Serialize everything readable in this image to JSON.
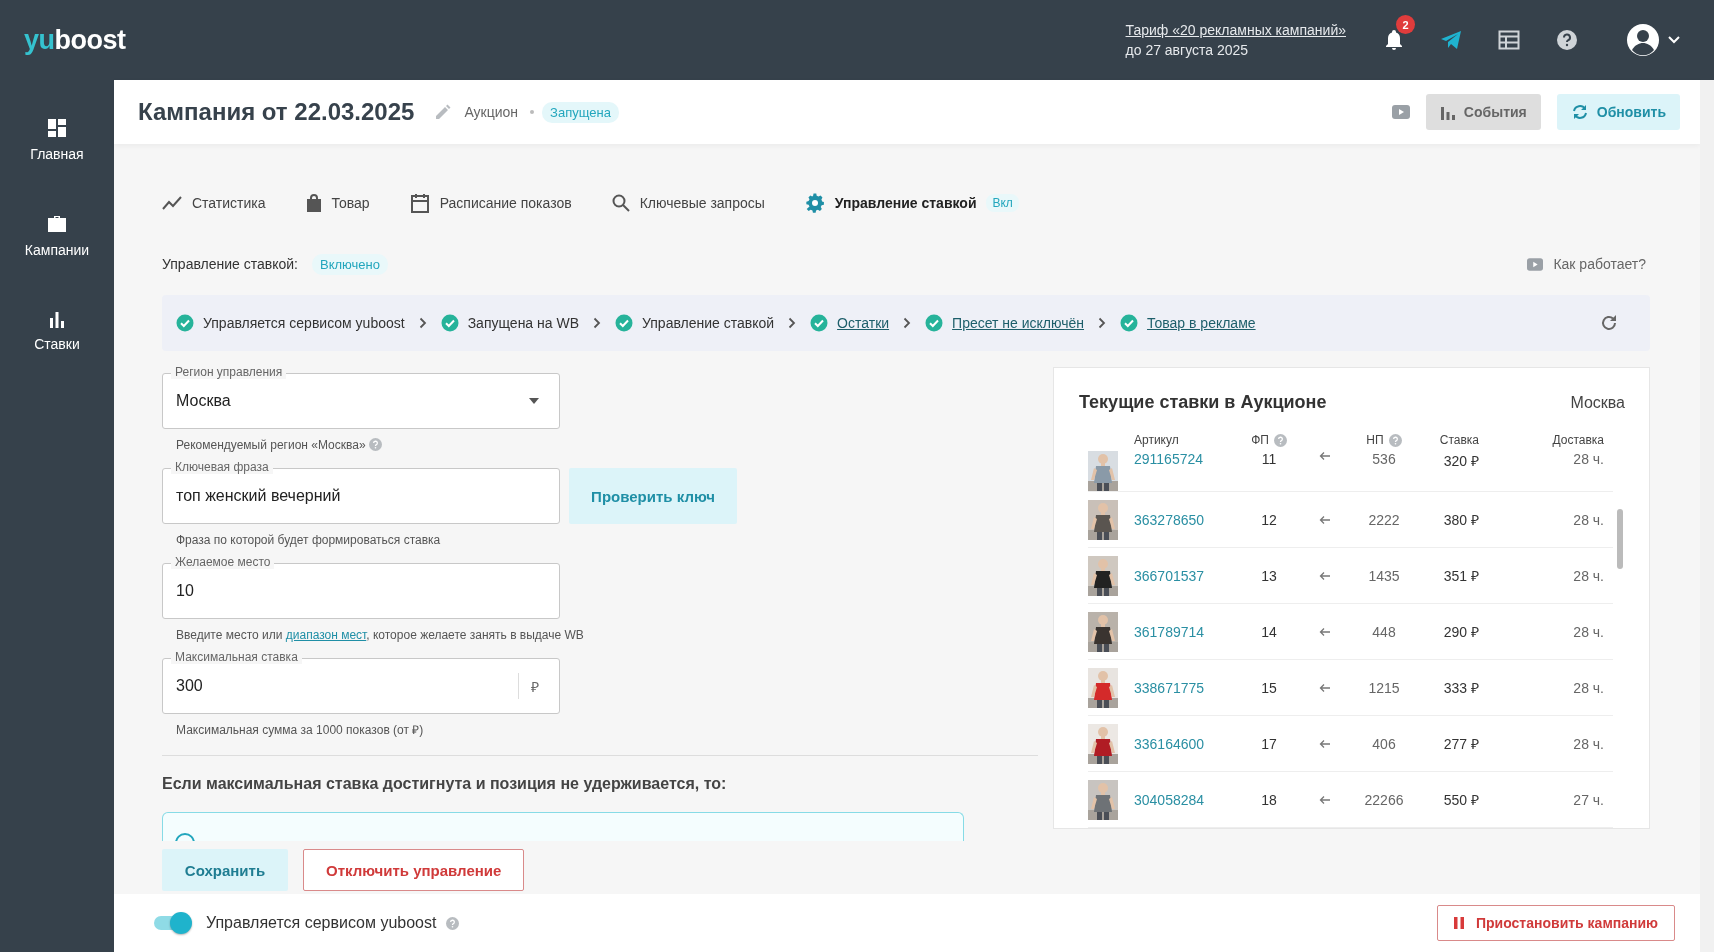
{
  "topbar": {
    "logo": [
      "yu",
      "boost"
    ],
    "tariff_link": "Тариф «20 рекламных кампаний»",
    "tariff_until": "до 27 августа 2025",
    "notifications_badge": "2"
  },
  "sidebar": {
    "items": [
      {
        "label": "Главная",
        "selected": false
      },
      {
        "label": "Кампании",
        "selected": false
      },
      {
        "label": "Ставки",
        "selected": false
      }
    ]
  },
  "header": {
    "title": "Кампания от 22.03.2025",
    "type": "Аукцион",
    "status": "Запущена",
    "buttons": [
      {
        "label": "События",
        "kind": "events"
      },
      {
        "label": "Обновить",
        "kind": "refresh"
      }
    ]
  },
  "tabs": [
    {
      "label": "Статистика",
      "selected": false
    },
    {
      "label": "Товар",
      "selected": false
    },
    {
      "label": "Расписание показов",
      "selected": false
    },
    {
      "label": "Ключевые запросы",
      "selected": false
    },
    {
      "label": "Управление ставкой",
      "selected": true,
      "badge": "Вкл"
    }
  ],
  "management": {
    "label": "Управление ставкой:",
    "state": "Включено",
    "help_link": "Как работает?"
  },
  "checks": [
    {
      "label": "Управляется сервисом yuboost",
      "link": false
    },
    {
      "label": "Запущена на WB",
      "link": false
    },
    {
      "label": "Управление ставкой",
      "link": false
    },
    {
      "label": "Остатки",
      "link": true
    },
    {
      "label": "Пресет не исключён",
      "link": true
    },
    {
      "label": "Товар в рекламе",
      "link": true
    }
  ],
  "form": {
    "region": {
      "label": "Регион управления",
      "value": "Москва",
      "hint": "Рекомендуемый регион «Москва»"
    },
    "keyword": {
      "label": "Ключевая фраза",
      "value": "топ женский вечерний",
      "button": "Проверить ключ",
      "hint": "Фраза по которой будет формироваться ставка"
    },
    "place": {
      "label": "Желаемое место",
      "value": "10",
      "hint_before": "Введите место или",
      "hint_link": "диапазон мест",
      "hint_after": ", которое желаете занять в выдаче WB"
    },
    "max_bid": {
      "label": "Максимальная ставка",
      "value": "300",
      "suffix": "₽",
      "hint": "Максимальная сумма за 1000 показов (от ₽)"
    },
    "fallback_title": "Если максимальная ставка достигнута и позиция не удерживается, то:",
    "save": "Сохранить",
    "disable": "Отключить управление"
  },
  "auction": {
    "title": "Текущие ставки в Аукционе",
    "region": "Москва",
    "columns": [
      {
        "label": "Артикул",
        "help": false
      },
      {
        "label": "ФП",
        "help": true
      },
      {
        "label": "НП",
        "help": true
      },
      {
        "label": "Ставка",
        "help": false
      },
      {
        "label": "Доставка",
        "help": false
      }
    ],
    "rows": [
      {
        "article": "291165724",
        "fp": "11",
        "np": "536",
        "bid": "320 ₽",
        "delivery": "28 ч."
      },
      {
        "article": "363278650",
        "fp": "12",
        "np": "2222",
        "bid": "380 ₽",
        "delivery": "28 ч."
      },
      {
        "article": "366701537",
        "fp": "13",
        "np": "1435",
        "bid": "351 ₽",
        "delivery": "28 ч."
      },
      {
        "article": "361789714",
        "fp": "14",
        "np": "448",
        "bid": "290 ₽",
        "delivery": "28 ч."
      },
      {
        "article": "338671775",
        "fp": "15",
        "np": "1215",
        "bid": "333 ₽",
        "delivery": "28 ч."
      },
      {
        "article": "336164600",
        "fp": "17",
        "np": "406",
        "bid": "277 ₽",
        "delivery": "28 ч."
      },
      {
        "article": "304058284",
        "fp": "18",
        "np": "22266",
        "bid": "550 ₽",
        "delivery": "27 ч."
      }
    ]
  },
  "footer": {
    "toggle_on": true,
    "toggle_label": "Управляется сервисом yuboost",
    "pause": "Приостановить кампанию"
  }
}
